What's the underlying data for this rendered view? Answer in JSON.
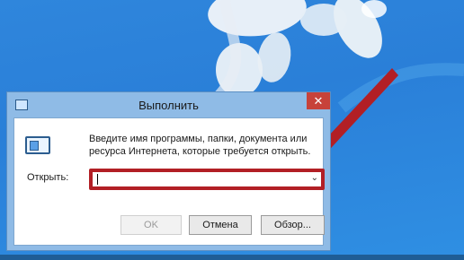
{
  "dialog": {
    "title": "Выполнить",
    "close_symbol": "✕",
    "description": "Введите имя программы, папки, документа или ресурса Интернета, которые требуется открыть.",
    "open_label": "Открыть:",
    "open_value": "",
    "buttons": {
      "ok": "OK",
      "cancel": "Отмена",
      "browse": "Обзор..."
    }
  },
  "icons": {
    "title": "run-icon",
    "body": "run-program-icon",
    "dropdown": "chevron-down-icon",
    "close": "close-icon"
  },
  "colors": {
    "highlight": "#b21f25",
    "close": "#c7423a"
  }
}
